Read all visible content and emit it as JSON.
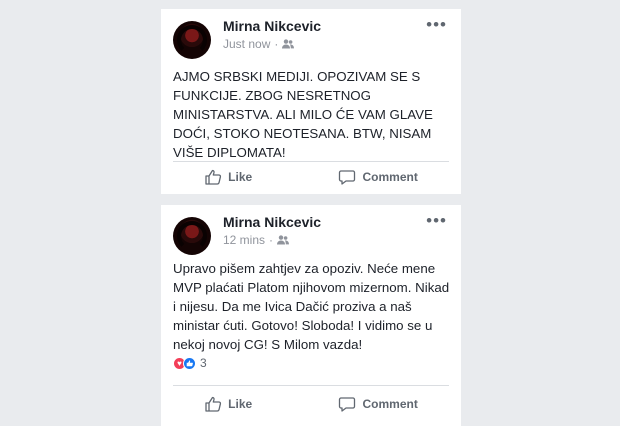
{
  "posts": [
    {
      "author": "Mirna Nikcevic",
      "time": "Just now",
      "privacy_icon": "friends-icon",
      "text": "AJMO SRBSKI MEDIJI. OPOZIVAM SE S FUNKCIJE. ZBOG NESRETNOG MINISTARSTVA. ALI MILO ĆE VAM GLAVE DOĆI, STOKO NEOTESANA. BTW, NISAM VIŠE DIPLOMATA!",
      "like_label": "Like",
      "comment_label": "Comment"
    },
    {
      "author": "Mirna Nikcevic",
      "time": "12 mins",
      "privacy_icon": "friends-icon",
      "text": "Upravo pišem zahtjev za opoziv. Neće mene MVP plaćati Platom njihovom mizernom. Nikad i nijesu. Da me Ivica Dačić proziva a naš ministar ćuti. Gotovo! Sloboda! I vidimo se u nekoj novoj CG! S Milom vazda!",
      "reaction_count": "3",
      "reaction_icons": [
        "love-icon",
        "like-icon"
      ],
      "like_label": "Like",
      "comment_label": "Comment"
    }
  ],
  "colors": {
    "background": "#e9ebee",
    "card": "#ffffff",
    "text": "#1d2129",
    "muted": "#90949c",
    "like_blue": "#1877f2",
    "love_red": "#f33e58"
  }
}
